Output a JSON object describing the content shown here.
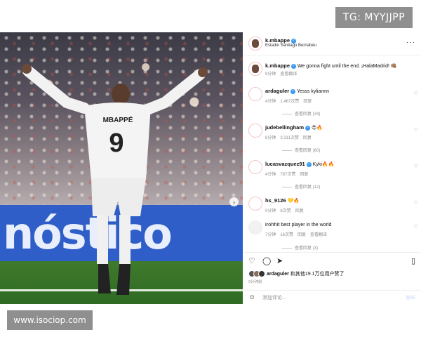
{
  "watermarks": {
    "top": "TG: MYYJJPP",
    "bottom": "www.isociop.com"
  },
  "photo": {
    "board_text": "nóstico",
    "jersey_name": "MBAPPÉ",
    "jersey_number": "9",
    "carousel_total": 4,
    "carousel_active": 1
  },
  "header": {
    "username": "k.mbappe",
    "location": "Estadio Santiago Bernabéu",
    "more": "···"
  },
  "caption": {
    "username": "k.mbappe",
    "text": "We gonna fight until the end. ¡HalaMadrid! 👊🏽",
    "time": "9分钟",
    "translate": "查看翻译"
  },
  "comments": [
    {
      "user": "ardaguler",
      "verified": true,
      "text": "Yesss kyliannn",
      "time": "4分钟",
      "likes": "1,467次赞",
      "reply": "回复",
      "replies": "查看回复 (34)"
    },
    {
      "user": "judebellingham",
      "verified": true,
      "text": "😍🔥",
      "time": "8分钟",
      "likes": "3,311次赞",
      "reply": "回复",
      "replies": "查看回复 (60)"
    },
    {
      "user": "lucasvazquez91",
      "verified": true,
      "text": "Kyki🔥🔥",
      "time": "4分钟",
      "likes": "787次赞",
      "reply": "回复",
      "replies": "查看回复 (12)"
    },
    {
      "user": "hs_9126",
      "verified": false,
      "text": "💛🔥",
      "time": "0分钟",
      "likes": "8次赞",
      "reply": "回复",
      "replies": ""
    },
    {
      "user": "irohhit",
      "verified": false,
      "text": "best player in the world",
      "time": "7分钟",
      "likes": "16次赞",
      "reply": "回复",
      "translate": "查看翻译",
      "replies": "查看回复 (3)"
    }
  ],
  "likes_line": {
    "user": "ardaguler",
    "text": "和其他19.1万位用户赞了"
  },
  "post_time": "9分钟前",
  "add_comment": {
    "placeholder": "添加评论...",
    "post": "发布"
  },
  "icons": {
    "like": "heart-icon",
    "comment": "comment-icon",
    "share": "send-icon",
    "save": "bookmark-icon",
    "emoji": "emoji-icon"
  }
}
